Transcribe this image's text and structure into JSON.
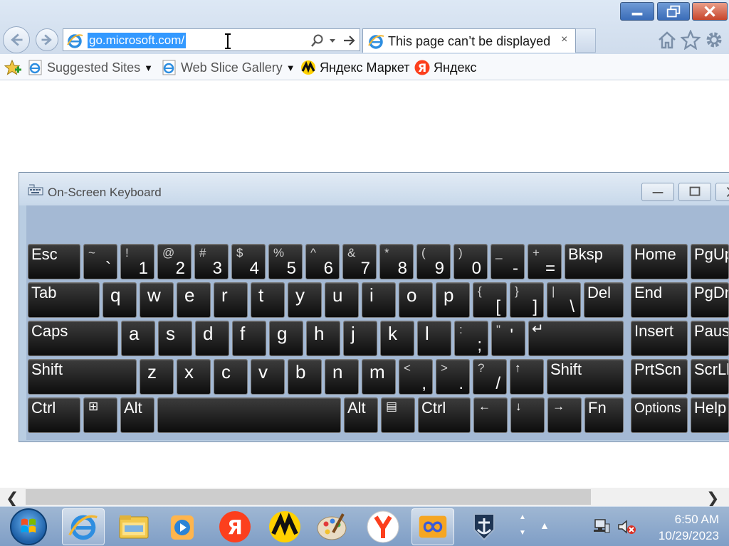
{
  "browser": {
    "address": "go.microsoft.com/",
    "tab_title": "This page can’t be displayed",
    "tab_close": "×"
  },
  "favorites": {
    "items": [
      {
        "label": "Suggested Sites",
        "dropdown": true
      },
      {
        "label": "Web Slice Gallery",
        "dropdown": true
      },
      {
        "label": "Яндекс Маркет",
        "dropdown": false
      },
      {
        "label": "Яндекс",
        "dropdown": false
      }
    ]
  },
  "osk": {
    "title": "On-Screen Keyboard",
    "rows": {
      "row1": [
        {
          "main": "Esc"
        },
        {
          "shift": "~",
          "main": "`"
        },
        {
          "shift": "!",
          "main": "1"
        },
        {
          "shift": "@",
          "main": "2"
        },
        {
          "shift": "#",
          "main": "3"
        },
        {
          "shift": "$",
          "main": "4"
        },
        {
          "shift": "%",
          "main": "5"
        },
        {
          "shift": "^",
          "main": "6"
        },
        {
          "shift": "&",
          "main": "7"
        },
        {
          "shift": "*",
          "main": "8"
        },
        {
          "shift": "(",
          "main": "9"
        },
        {
          "shift": ")",
          "main": "0"
        },
        {
          "shift": "_",
          "main": "-"
        },
        {
          "shift": "+",
          "main": "="
        },
        {
          "main": "Bksp"
        }
      ],
      "row2": [
        {
          "main": "Tab"
        },
        {
          "main": "q"
        },
        {
          "main": "w"
        },
        {
          "main": "e"
        },
        {
          "main": "r"
        },
        {
          "main": "t"
        },
        {
          "main": "y"
        },
        {
          "main": "u"
        },
        {
          "main": "i"
        },
        {
          "main": "o"
        },
        {
          "main": "p"
        },
        {
          "shift": "{",
          "main": "["
        },
        {
          "shift": "}",
          "main": "]"
        },
        {
          "shift": "|",
          "main": "\\"
        },
        {
          "main": "Del"
        }
      ],
      "row3": [
        {
          "main": "Caps"
        },
        {
          "main": "a"
        },
        {
          "main": "s"
        },
        {
          "main": "d"
        },
        {
          "main": "f"
        },
        {
          "main": "g"
        },
        {
          "main": "h"
        },
        {
          "main": "j"
        },
        {
          "main": "k"
        },
        {
          "main": "l"
        },
        {
          "shift": ":",
          "main": ";"
        },
        {
          "shift": "\"",
          "main": "'"
        },
        {
          "main": "↵"
        }
      ],
      "row4": [
        {
          "main": "Shift"
        },
        {
          "main": "z"
        },
        {
          "main": "x"
        },
        {
          "main": "c"
        },
        {
          "main": "v"
        },
        {
          "main": "b"
        },
        {
          "main": "n"
        },
        {
          "main": "m"
        },
        {
          "shift": "<",
          "main": ","
        },
        {
          "shift": ">",
          "main": "."
        },
        {
          "shift": "?",
          "main": "/"
        },
        {
          "main": "↑"
        },
        {
          "main": "Shift"
        }
      ],
      "row5": [
        {
          "main": "Ctrl"
        },
        {
          "main": "⊞"
        },
        {
          "main": "Alt"
        },
        {
          "main": ""
        },
        {
          "main": "Alt"
        },
        {
          "main": "▤"
        },
        {
          "main": "Ctrl"
        },
        {
          "main": "←"
        },
        {
          "main": "↓"
        },
        {
          "main": "→"
        },
        {
          "main": "Fn"
        }
      ]
    },
    "nav": [
      "Home",
      "PgUp",
      "End",
      "PgDn",
      "Insert",
      "Pause",
      "PrtScn",
      "ScrLk",
      "Options",
      "Help"
    ]
  },
  "taskbar": {
    "time": "6:50 AM",
    "date": "10/29/2023"
  }
}
